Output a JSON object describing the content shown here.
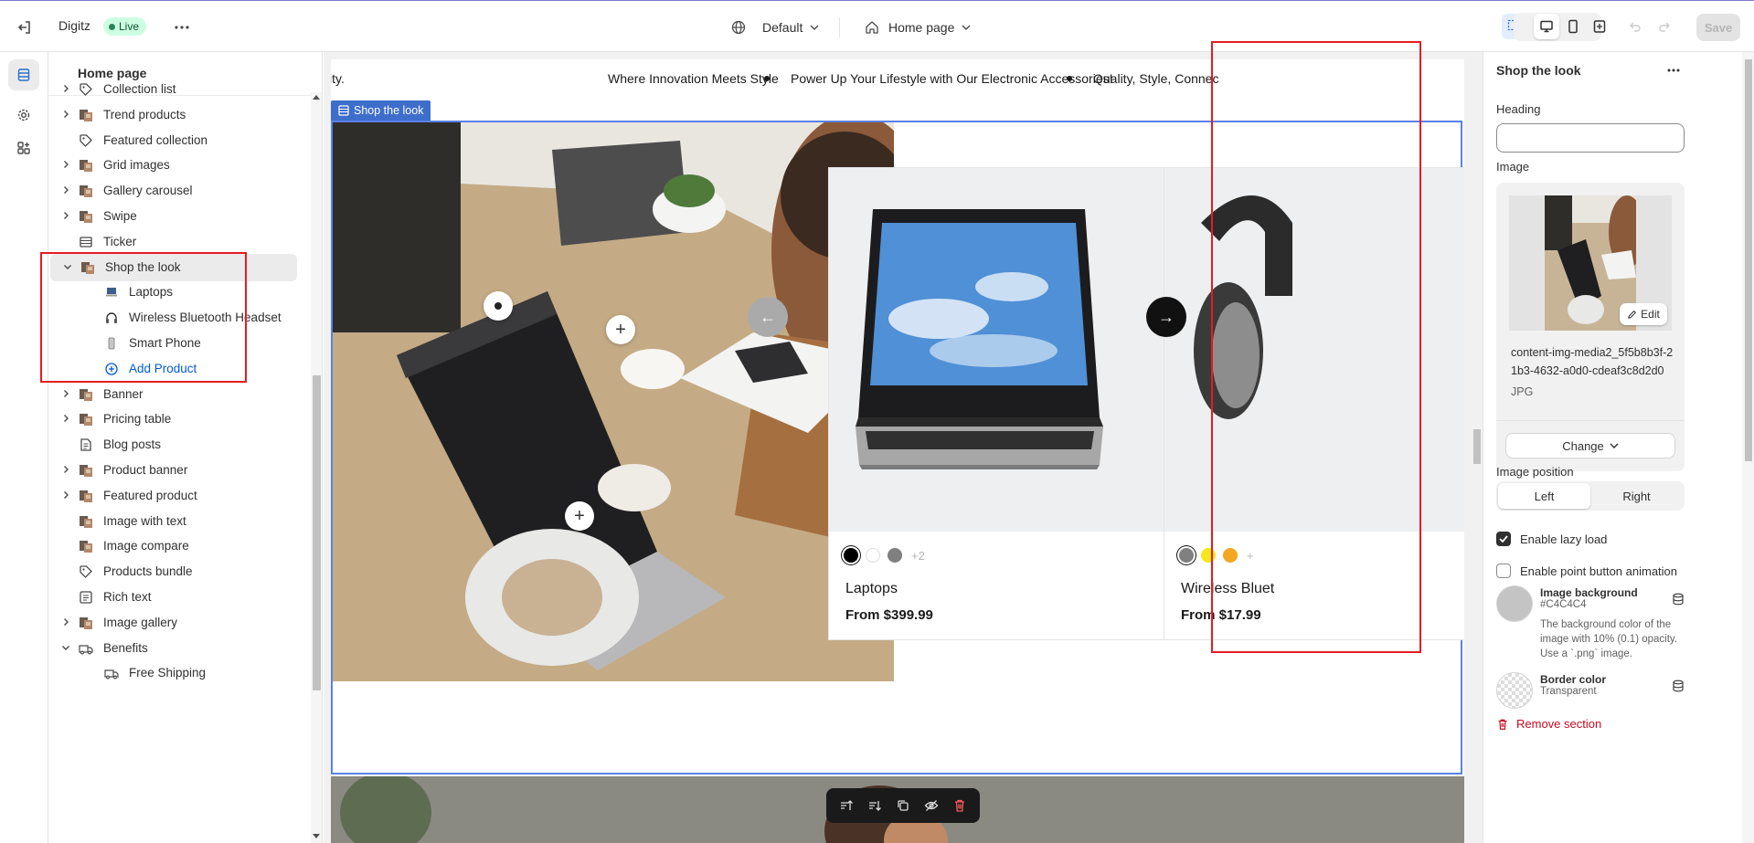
{
  "topbar": {
    "store_name": "Digitz",
    "status_badge": "Live",
    "theme_select": "Default",
    "page_select": "Home page",
    "save_label": "Save"
  },
  "sidebar": {
    "title": "Home page",
    "items": [
      {
        "label": "Collection list",
        "icon": "collection-icon",
        "expandable": true
      },
      {
        "label": "Trend products",
        "icon": "image-section-icon",
        "expandable": true
      },
      {
        "label": "Featured collection",
        "icon": "collection-icon",
        "expandable": false
      },
      {
        "label": "Grid images",
        "icon": "image-section-icon",
        "expandable": true
      },
      {
        "label": "Gallery carousel",
        "icon": "image-section-icon",
        "expandable": true
      },
      {
        "label": "Swipe",
        "icon": "image-section-icon",
        "expandable": true
      },
      {
        "label": "Ticker",
        "icon": "ticker-icon",
        "expandable": false
      },
      {
        "label": "Shop the look",
        "icon": "image-section-icon",
        "expandable": true,
        "expanded": true,
        "selected": true
      },
      {
        "label": "Banner",
        "icon": "image-section-icon",
        "expandable": true
      },
      {
        "label": "Pricing table",
        "icon": "image-section-icon",
        "expandable": true
      },
      {
        "label": "Blog posts",
        "icon": "blog-icon",
        "expandable": false
      },
      {
        "label": "Product banner",
        "icon": "image-section-icon",
        "expandable": true
      },
      {
        "label": "Featured product",
        "icon": "image-section-icon",
        "expandable": true
      },
      {
        "label": "Image with text",
        "icon": "image-section-icon",
        "expandable": false
      },
      {
        "label": "Image compare",
        "icon": "image-section-icon",
        "expandable": false
      },
      {
        "label": "Products bundle",
        "icon": "collection-icon",
        "expandable": false
      },
      {
        "label": "Rich text",
        "icon": "text-icon",
        "expandable": false
      },
      {
        "label": "Image gallery",
        "icon": "image-section-icon",
        "expandable": true
      },
      {
        "label": "Benefits",
        "icon": "benefits-icon",
        "expandable": true,
        "expanded": true
      }
    ],
    "shop_the_look_children": [
      {
        "label": "Laptops",
        "icon": "laptop-icon"
      },
      {
        "label": "Wireless Bluetooth Headset",
        "icon": "headphones-icon"
      },
      {
        "label": "Smart Phone",
        "icon": "phone-icon"
      }
    ],
    "add_product_label": "Add Product",
    "benefits_children": [
      {
        "label": "Free Shipping",
        "icon": "shipping-icon"
      }
    ]
  },
  "canvas": {
    "ticker": [
      "vity.",
      "Where Innovation Meets Style",
      "Power Up Your Lifestyle with Our Electronic Accessories!",
      "Quality, Style, Connec"
    ],
    "section_tag": "Shop the look",
    "products": [
      {
        "title": "Laptops",
        "price": "From $399.99",
        "swatches": [
          "#000000",
          "#ffffff",
          "#808080"
        ],
        "more": "+2"
      },
      {
        "title": "Wireless Bluet",
        "price": "From $17.99",
        "swatches": [
          "#808080",
          "#f5e61e",
          "#f5a623"
        ],
        "more": "+"
      }
    ]
  },
  "panel": {
    "title": "Shop the look",
    "heading_label": "Heading",
    "heading_value": "",
    "image_label": "Image",
    "image_edit": "Edit",
    "image_name": "content-img-media2_5f5b8b3f-21b3-4632-a0d0-cdeaf3c8d2d0",
    "image_type": "JPG",
    "change_label": "Change",
    "image_position_label": "Image position",
    "position_left": "Left",
    "position_right": "Right",
    "position_selected": "Left",
    "lazy_load_label": "Enable lazy load",
    "lazy_load_checked": true,
    "point_anim_label": "Enable point button animation",
    "point_anim_checked": false,
    "image_bg_label": "Image background",
    "image_bg_value": "#C4C4C4",
    "image_bg_help": "The background color of the image with 10% (0.1) opacity. Use a `.png` image.",
    "border_color_label": "Border color",
    "border_color_value": "Transparent",
    "remove_label": "Remove section"
  },
  "colors": {
    "accent": "#005bd3",
    "selection_frame": "#5a82e6",
    "highlight_box": "#e51c23",
    "live_badge_bg": "#cdfee1"
  }
}
